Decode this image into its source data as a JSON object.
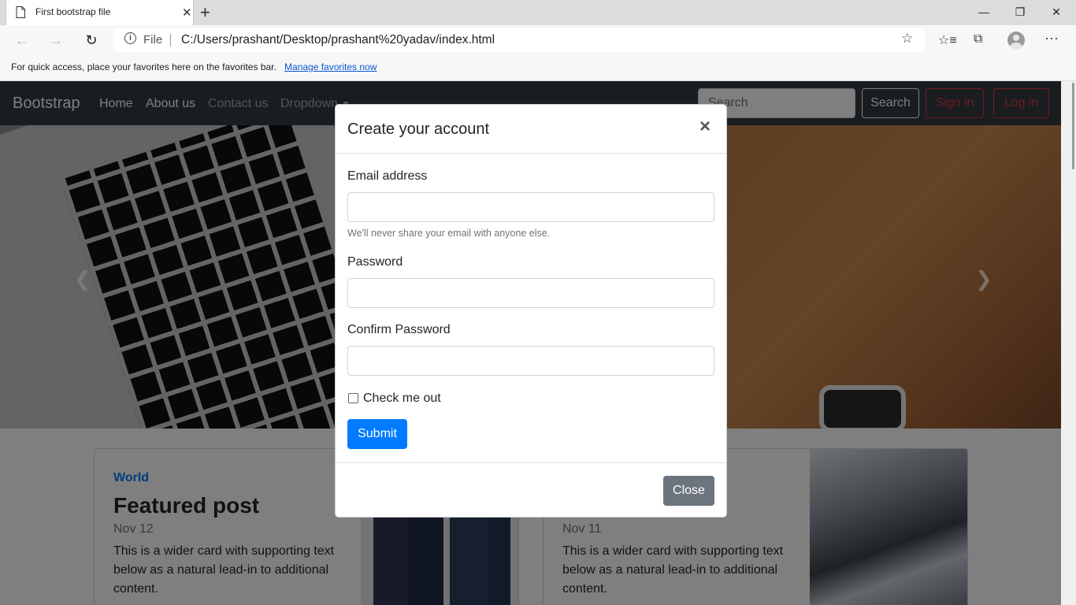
{
  "browser": {
    "tab_title": "First bootstrap file",
    "address_scheme_label": "File",
    "url": "C:/Users/prashant/Desktop/prashant%20yadav/index.html",
    "favorites_hint": "For quick access, place your favorites here on the favorites bar.",
    "favorites_link": "Manage favorites now"
  },
  "navbar": {
    "brand": "Bootstrap",
    "links": [
      "Home",
      "About us",
      "Contact us",
      "Dropdown"
    ],
    "search_placeholder": "Search",
    "search_button": "Search",
    "signin_button": "Sign in",
    "login_button": "Log in"
  },
  "cards": [
    {
      "category": "World",
      "title": "Featured post",
      "date": "Nov 12",
      "text": "This is a wider card with supporting text below as a natural lead-in to additional content."
    },
    {
      "category": "",
      "title": "",
      "date": "Nov 11",
      "text": "This is a wider card with supporting text below as a natural lead-in to additional content."
    }
  ],
  "modal": {
    "title": "Create your account",
    "email_label": "Email address",
    "email_help": "We'll never share your email with anyone else.",
    "password_label": "Password",
    "confirm_label": "Confirm Password",
    "check_label": "Check me out",
    "checked": false,
    "submit": "Submit",
    "close": "Close"
  },
  "colors": {
    "primary": "#007bff",
    "danger": "#dc3545",
    "navbar_bg": "#343a40",
    "secondary": "#6c757d"
  }
}
